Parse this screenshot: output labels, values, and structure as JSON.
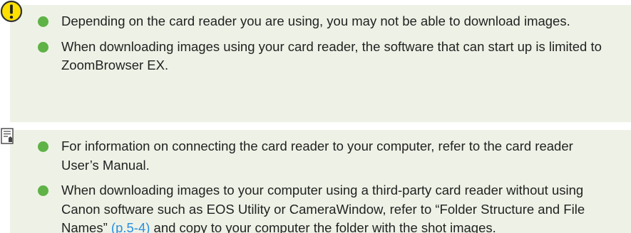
{
  "caution": {
    "icon": "caution-icon",
    "items": [
      {
        "text": "Depending on the card reader you are using, you may not be able to download images."
      },
      {
        "text": "When downloading images using your card reader, the software that can start up is limited to ZoomBrowser EX."
      }
    ]
  },
  "memo": {
    "icon": "memo-icon",
    "items": [
      {
        "text": "For information on connecting the card reader to your computer, refer to the card reader User’s Manual."
      },
      {
        "text_before": "When downloading images to your computer using a third-party card reader without using Canon software such as EOS Utility or CameraWindow, refer to “Folder Structure and File Names” ",
        "link": "(p.5-4)",
        "text_after": " and copy to your computer the folder with the shot images."
      }
    ]
  },
  "colors": {
    "box_background": "#eef2e6",
    "bullet": "#5fb246",
    "caution_icon_fill": "#ffe000",
    "link": "#2a8fe0"
  }
}
